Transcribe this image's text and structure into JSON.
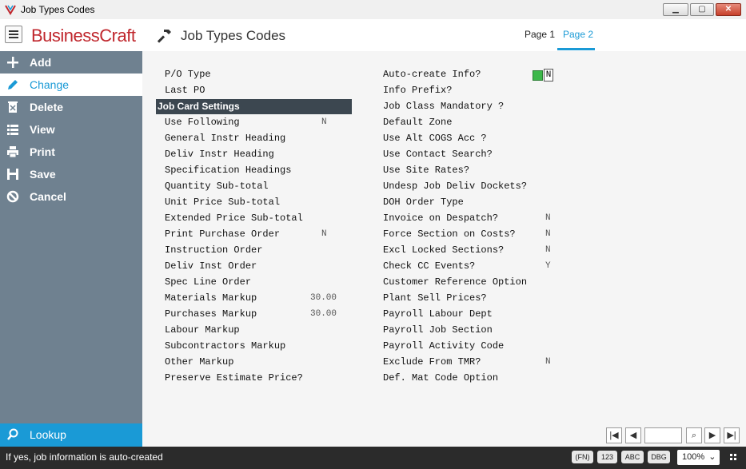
{
  "window": {
    "title": "Job Types Codes"
  },
  "header": {
    "brand": "BusinessCraft",
    "page_title": "Job Types Codes",
    "tabs": [
      "Page 1",
      "Page 2"
    ]
  },
  "sidebar": {
    "items": [
      {
        "label": "Add",
        "icon": "plus-icon"
      },
      {
        "label": "Change",
        "icon": "pencil-icon"
      },
      {
        "label": "Delete",
        "icon": "trash-icon"
      },
      {
        "label": "View",
        "icon": "list-icon"
      },
      {
        "label": "Print",
        "icon": "printer-icon"
      },
      {
        "label": "Save",
        "icon": "floppy-icon"
      },
      {
        "label": "Cancel",
        "icon": "cancel-icon"
      }
    ],
    "lookup": "Lookup"
  },
  "left_fields": {
    "po_type": "P/O Type",
    "last_po": "Last PO",
    "section": "Job Card Settings",
    "rows": [
      {
        "label": "Use Following",
        "value": "N"
      },
      {
        "label": "General Instr Heading",
        "value": ""
      },
      {
        "label": "Deliv Instr Heading",
        "value": ""
      },
      {
        "label": "Specification Headings",
        "value": ""
      },
      {
        "label": "Quantity Sub-total",
        "value": ""
      },
      {
        "label": "Unit Price Sub-total",
        "value": ""
      },
      {
        "label": "Extended Price Sub-total",
        "value": ""
      },
      {
        "label": "Print Purchase Order",
        "value": "N"
      },
      {
        "label": "Instruction Order",
        "value": ""
      },
      {
        "label": "Deliv Inst Order",
        "value": ""
      },
      {
        "label": "Spec Line Order",
        "value": ""
      },
      {
        "label": "Materials Markup",
        "value": "30.00"
      },
      {
        "label": "Purchases Markup",
        "value": "30.00"
      },
      {
        "label": "Labour Markup",
        "value": ""
      },
      {
        "label": "Subcontractors Markup",
        "value": ""
      },
      {
        "label": "Other Markup",
        "value": ""
      },
      {
        "label": "Preserve Estimate Price?",
        "value": ""
      }
    ]
  },
  "right_fields": {
    "auto_create_value": "N",
    "rows": [
      {
        "label": "Auto-create Info?",
        "value": ""
      },
      {
        "label": "Info Prefix?",
        "value": ""
      },
      {
        "label": "Job Class Mandatory ?",
        "value": ""
      },
      {
        "label": "Default Zone",
        "value": ""
      },
      {
        "label": "Use Alt COGS Acc ?",
        "value": ""
      },
      {
        "label": "Use Contact Search?",
        "value": ""
      },
      {
        "label": "Use Site Rates?",
        "value": ""
      },
      {
        "label": "Undesp Job Deliv Dockets?",
        "value": ""
      },
      {
        "label": "DOH Order Type",
        "value": ""
      },
      {
        "label": "Invoice on Despatch?",
        "value": "N"
      },
      {
        "label": "Force Section on Costs?",
        "value": "N"
      },
      {
        "label": "Excl Locked Sections?",
        "value": "N"
      },
      {
        "label": "Check CC Events?",
        "value": "Y"
      },
      {
        "label": "Customer Reference Option",
        "value": ""
      },
      {
        "label": "Plant Sell Prices?",
        "value": ""
      },
      {
        "label": "Payroll Labour Dept",
        "value": ""
      },
      {
        "label": "Payroll Job Section",
        "value": ""
      },
      {
        "label": "Payroll Activity Code",
        "value": ""
      },
      {
        "label": "Exclude From TMR?",
        "value": "N"
      },
      {
        "label": "Def. Mat Code Option",
        "value": ""
      }
    ]
  },
  "status": {
    "text": "If yes, job information is auto-created",
    "pills": [
      "(FN)",
      "123",
      "ABC",
      "DBG"
    ],
    "zoom": "100%"
  },
  "colors": {
    "accent": "#1a9ad6",
    "sidebar": "#6f8190",
    "brand": "#c0272d"
  }
}
